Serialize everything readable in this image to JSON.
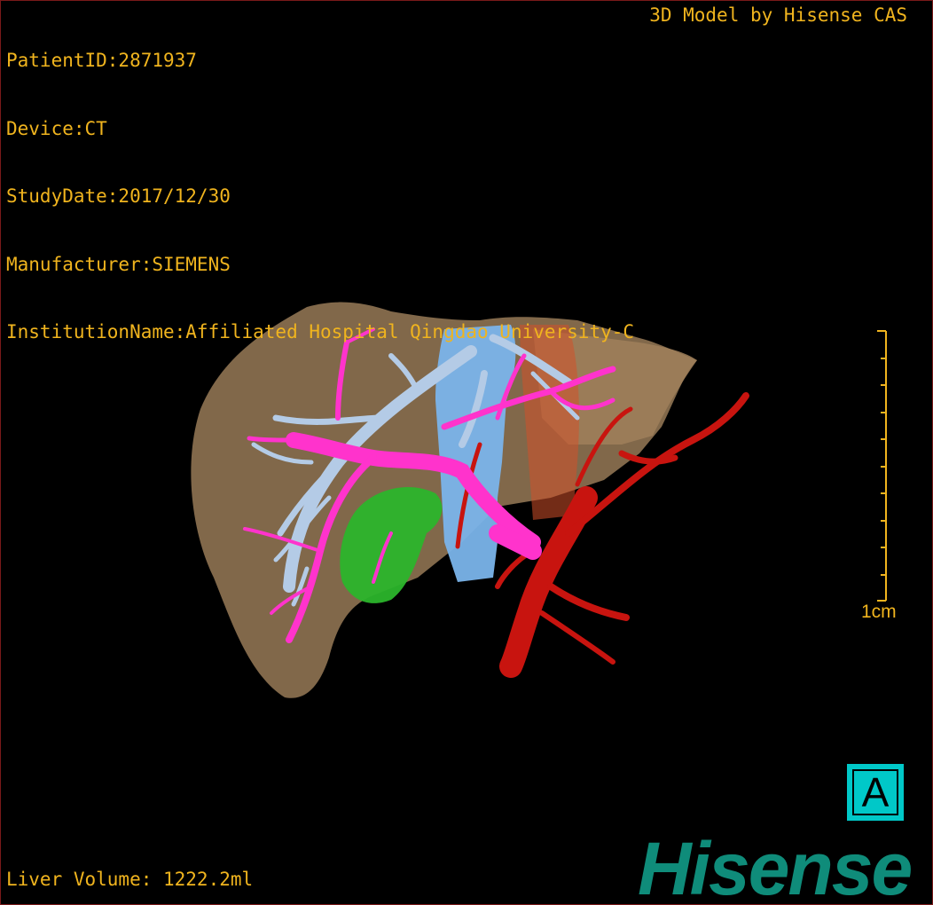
{
  "header": {
    "patient_id": "PatientID:2871937",
    "device": "Device:CT",
    "study_date": "StudyDate:2017/12/30",
    "manufacturer": "Manufacturer:SIEMENS",
    "institution": "InstitutionName:Affiliated Hospital Qingdao University-C"
  },
  "credit": "3D Model by Hisense CAS",
  "footer": {
    "liver_volume": "Liver Volume: 1222.2ml"
  },
  "scale_bar": {
    "label": "1cm"
  },
  "orientation_marker": {
    "label": "A"
  },
  "brand": {
    "logo_text": "Hisense"
  },
  "colors": {
    "overlay_text": "#f0b41e",
    "liver": "#9a7a55",
    "portal_vein": "#ff33cc",
    "hepatic_vein": "#b0c8e8",
    "inferior_vena_cava": "#6aaee8",
    "artery": "#c8140f",
    "gallbladder": "#2bb52b",
    "orientation_bg": "#00c8c8",
    "brand": "#0f8c7a"
  }
}
